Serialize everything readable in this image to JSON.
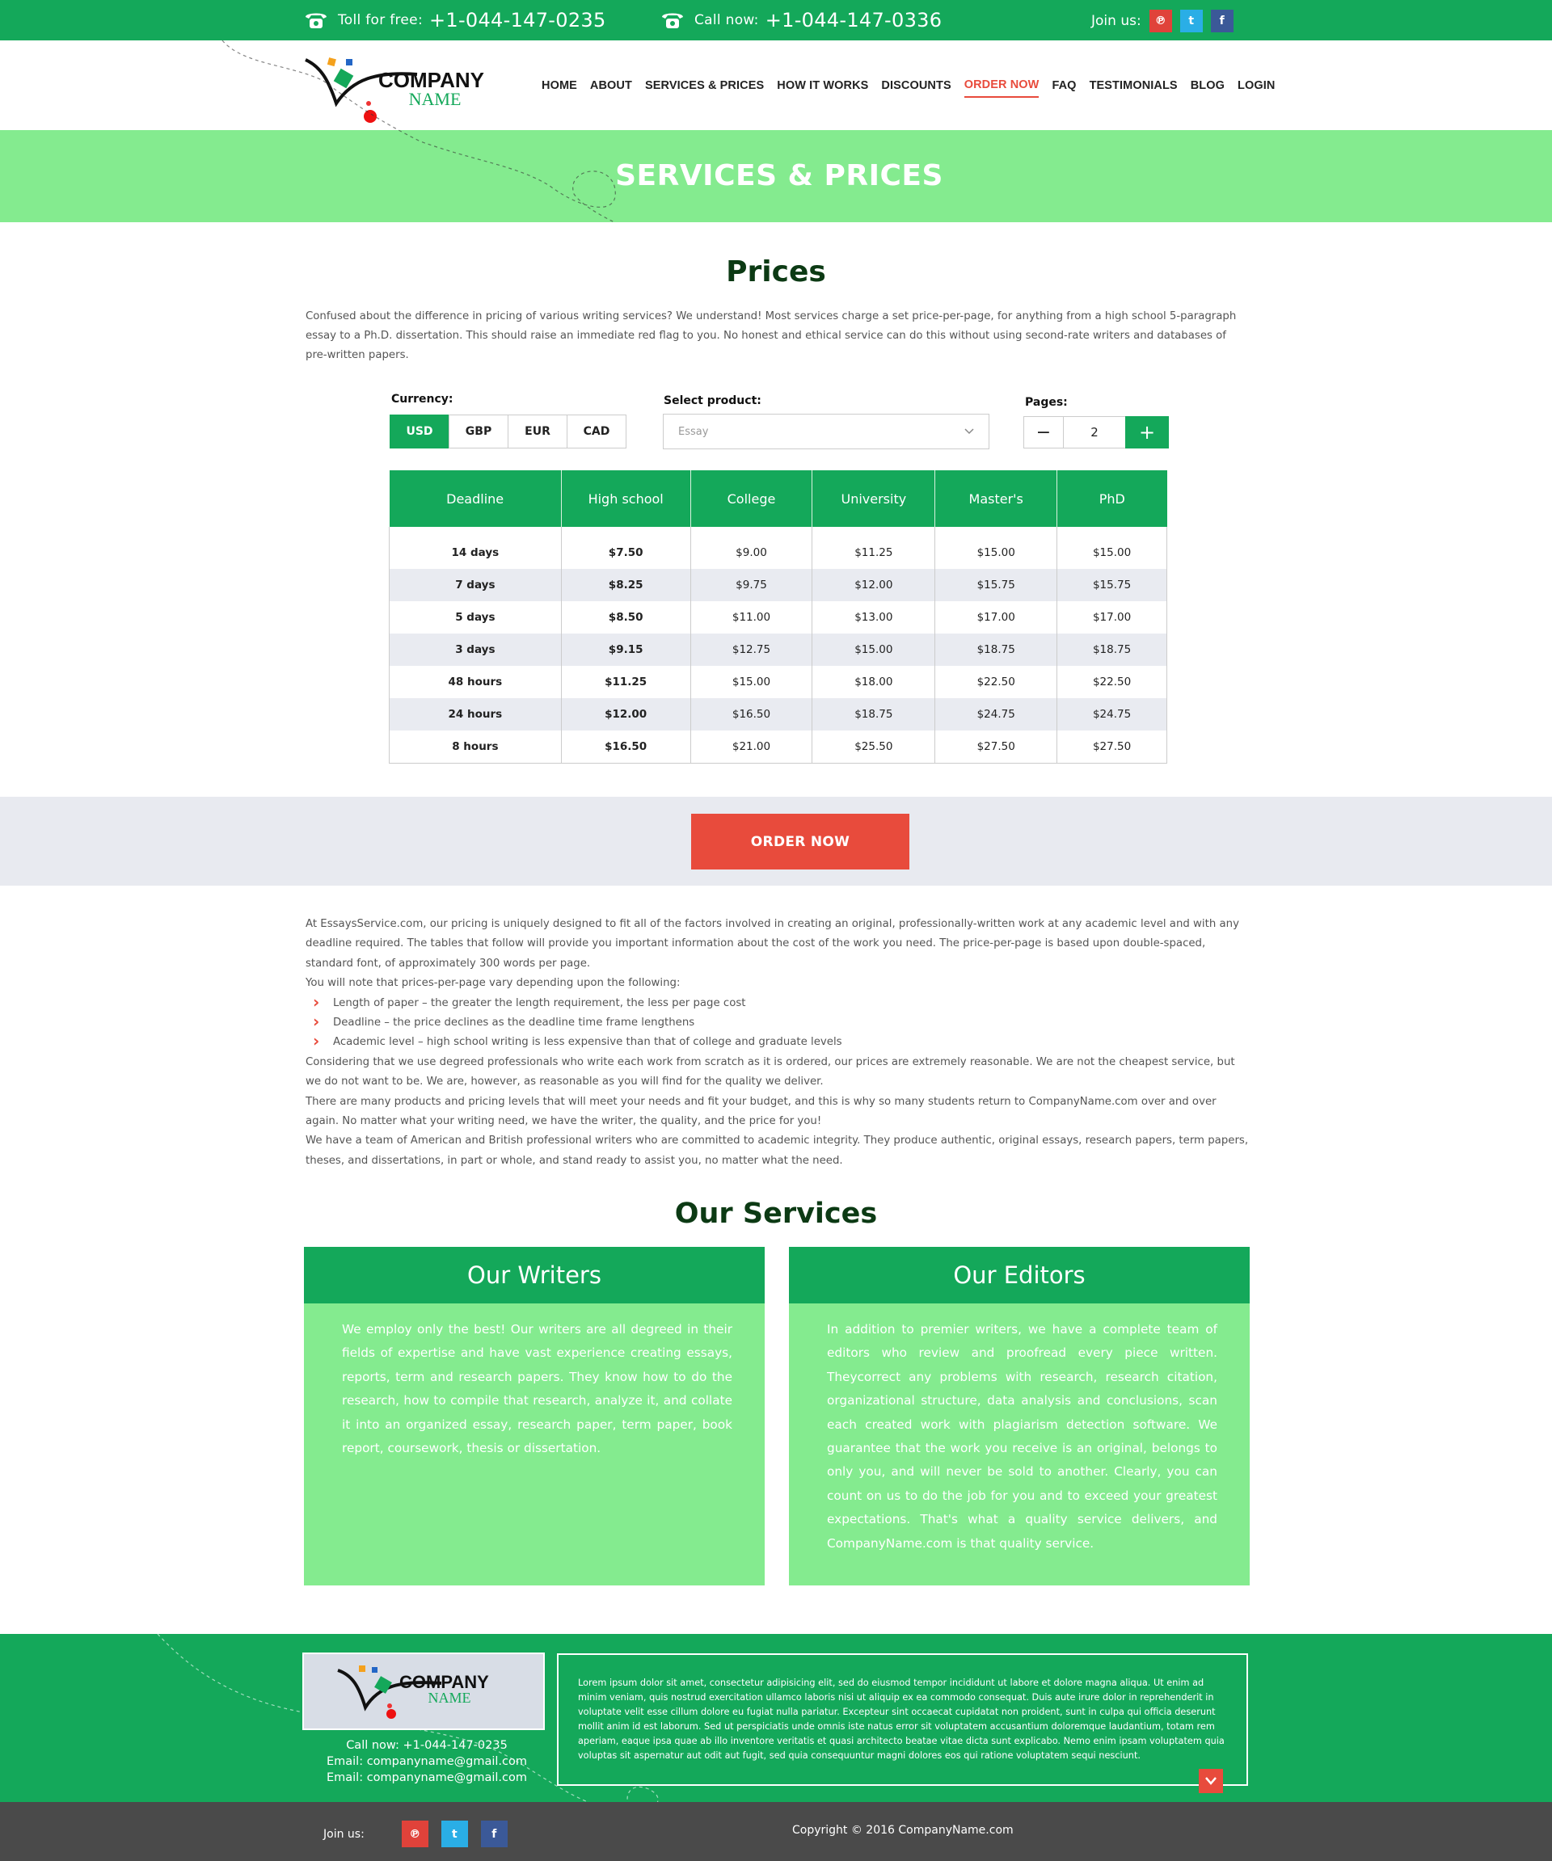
{
  "topbar": {
    "toll_label": "Toll for free:",
    "toll_number": "+1-044-147-0235",
    "call_label": "Call now:",
    "call_number": "+1-044-147-0336",
    "join_label": "Join us:"
  },
  "logo": {
    "line1": "COMPANY",
    "line2": "NAME"
  },
  "nav": [
    "HOME",
    "ABOUT",
    "SERVICES & PRICES",
    "HOW IT WORKS",
    "DISCOUNTS",
    "ORDER NOW",
    "FAQ",
    "TESTIMONIALS",
    "BLOG",
    "LOGIN"
  ],
  "banner": {
    "title": "SERVICES & PRICES"
  },
  "prices": {
    "title": "Prices",
    "intro": "Confused about the difference in pricing of various writing services? We understand!  Most services charge a set price-per-page, for anything from a high school 5-paragraph essay to a Ph.D. dissertation. This should raise an immediate red flag to you.  No honest and ethical service can do this without using second-rate writers and databases of pre-written papers.",
    "currency_label": "Currency:",
    "currencies": [
      "USD",
      "GBP",
      "EUR",
      "CAD"
    ],
    "product_label": "Select product:",
    "product_value": "Essay",
    "pages_label": "Pages:",
    "pages_value": "2",
    "minus": "−",
    "plus": "+"
  },
  "table": {
    "headers": [
      "Deadline",
      "High school",
      "College",
      "University",
      "Master's",
      "PhD"
    ],
    "rows": [
      [
        "14 days",
        "$7.50",
        "$9.00",
        "$11.25",
        "$15.00",
        "$15.00"
      ],
      [
        "7 days",
        "$8.25",
        "$9.75",
        "$12.00",
        "$15.75",
        "$15.75"
      ],
      [
        "5 days",
        "$8.50",
        "$11.00",
        "$13.00",
        "$17.00",
        "$17.00"
      ],
      [
        "3 days",
        "$9.15",
        "$12.75",
        "$15.00",
        "$18.75",
        "$18.75"
      ],
      [
        "48 hours",
        "$11.25",
        "$15.00",
        "$18.00",
        "$22.50",
        "$22.50"
      ],
      [
        "24 hours",
        "$12.00",
        "$16.50",
        "$18.75",
        "$24.75",
        "$24.75"
      ],
      [
        "8 hours",
        "$16.50",
        "$21.00",
        "$25.50",
        "$27.50",
        "$27.50"
      ]
    ]
  },
  "order_button": "ORDER NOW",
  "info": {
    "p1": "At EssaysService.com, our pricing is uniquely designed to fit all of the factors involved in creating an original, professionally-written work at any academic level and with any deadline required.  The tables that follow will provide you important information about the cost of the work you need.  The price-per-page is based upon double-spaced, standard font, of approximately 300 words per page.",
    "p2": "You will note that prices-per-page vary depending upon the following:",
    "list": [
      "Length of paper – the greater the length requirement, the less per page cost",
      "Deadline  – the price declines as the deadline time frame lengthens",
      "Academic level – high school writing is less expensive than that of  college and graduate levels"
    ],
    "p3": "Considering that we use degreed professionals who write each work from scratch as it is ordered, our prices are extremely reasonable.  We are not the cheapest service, but we do not want to be.  We are, however, as reasonable as you will find for the quality we deliver.",
    "p4": "There are many products and pricing levels that will meet your needs and fit your budget, and this is why so many students return to CompanyName.com over and over again. No matter what your writing need, we have the writer, the quality, and the price for you!",
    "p5": "We have a team of American and British professional writers who are committed to academic integrity.  They produce authentic, original essays, research papers, term papers, theses, and dissertations, in part or whole, and stand ready to assist you, no matter what the need."
  },
  "services": {
    "title": "Our Services",
    "writers_title": "Our Writers",
    "writers_text": "We employ only the best!  Our writers are all degreed in their fields of expertise and have vast experience creating essays, reports, term and research papers.  They know how to do the research, how to compile that research, analyze it, and collate it into an organized essay, research paper, term paper, book report, coursework, thesis or dissertation.",
    "editors_title": "Our Editors",
    "editors_text": "In addition to premier writers, we have a complete team of editors who review and proofread every piece written.  Theycorrect any problems with research, research citation, organizational structure, data analysis and conclusions, scan each created work with plagiarism detection software.  We guarantee that the work you receive is an original, belongs to only you, and will never be sold to another.  Clearly, you can count on us to do the job for you and to exceed your greatest expectations.  That's what a quality service delivers, and CompanyName.com is that quality service."
  },
  "footer": {
    "call": "Call now: +1-044-147-0235",
    "email1": "Email: companyname@gmail.com",
    "email2": "Email: companyname@gmail.com",
    "lorem": "Lorem ipsum dolor sit amet, consectetur adipisicing elit, sed do eiusmod tempor incididunt ut labore et dolore magna aliqua. Ut enim ad minim veniam, quis nostrud exercitation ullamco laboris nisi ut aliquip ex ea commodo consequat. Duis aute irure dolor in reprehenderit in voluptate velit esse cillum dolore eu fugiat nulla pariatur. Excepteur sint occaecat cupidatat non proident, sunt in culpa qui officia deserunt mollit anim id est laborum. Sed ut perspiciatis unde omnis iste natus error sit voluptatem accusantium doloremque laudantium, totam rem aperiam, eaque ipsa quae ab illo inventore veritatis et quasi architecto beatae vitae dicta sunt explicabo. Nemo enim ipsam voluptatem quia voluptas sit aspernatur aut odit aut fugit, sed quia consequuntur magni dolores eos qui ratione voluptatem sequi nesciunt.",
    "join_label": "Join us:",
    "copyright": "Copyright © 2016 CompanyName.com"
  },
  "colors": {
    "green": "#14a85a",
    "light_green": "#84eb8f",
    "red": "#e84b3c",
    "dark": "#4a4a4a"
  }
}
